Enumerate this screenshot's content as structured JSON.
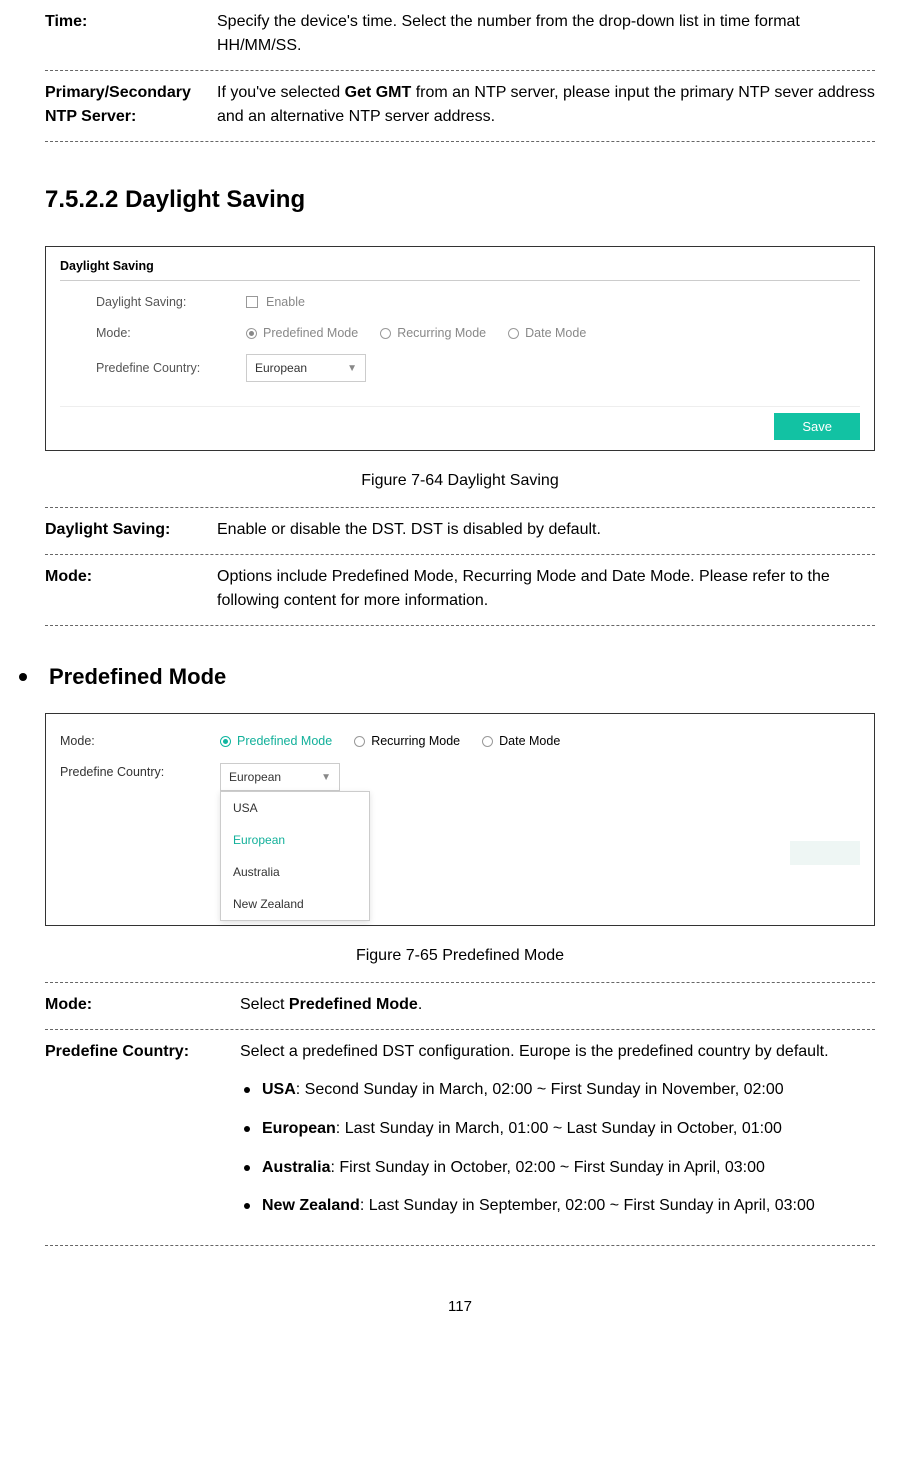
{
  "top_defs": [
    {
      "term": "Time:",
      "desc": "Specify the device's time. Select the number from the drop-down list in time format HH/MM/SS."
    },
    {
      "term": "Primary/Secondary NTP Server:",
      "desc_parts": [
        "If you've selected ",
        "Get GMT",
        " from an NTP server, please input the primary NTP sever address and an alternative NTP server address."
      ]
    }
  ],
  "section_heading": "7.5.2.2  Daylight Saving",
  "fig1": {
    "title": "Daylight Saving",
    "rows": {
      "ds_label": "Daylight Saving:",
      "ds_enable": "Enable",
      "mode_label": "Mode:",
      "mode_options": [
        "Predefined Mode",
        "Recurring Mode",
        "Date Mode"
      ],
      "pc_label": "Predefine Country:",
      "pc_value": "European"
    },
    "save": "Save"
  },
  "fig1_caption": "Figure 7-64 Daylight Saving",
  "ds_defs": [
    {
      "term": "Daylight Saving:",
      "desc": "Enable or disable the DST. DST is disabled by default."
    },
    {
      "term": "Mode:",
      "desc": "Options include Predefined Mode, Recurring Mode and Date Mode. Please refer to the following content for more information."
    }
  ],
  "bullet_heading": "Predefined Mode",
  "fig2": {
    "mode_label": "Mode:",
    "mode_options": [
      "Predefined Mode",
      "Recurring Mode",
      "Date Mode"
    ],
    "pc_label": "Predefine Country:",
    "pc_value": "European",
    "dd_items": [
      "USA",
      "European",
      "Australia",
      "New Zealand"
    ]
  },
  "fig2_caption": "Figure 7-65 Predefined Mode",
  "pd_defs": {
    "mode_term": "Mode:",
    "mode_desc_parts": [
      "Select ",
      "Predefined Mode",
      "."
    ],
    "pc_term": "Predefine Country:",
    "pc_desc": "Select a predefined DST configuration. Europe is the predefined country by default.",
    "countries": [
      {
        "name": "USA",
        "rest": ": Second Sunday in March, 02:00 ~ First Sunday in November, 02:00"
      },
      {
        "name": "European",
        "rest": ": Last Sunday in March, 01:00 ~ Last Sunday in October, 01:00"
      },
      {
        "name": "Australia",
        "rest": ": First Sunday in October, 02:00 ~ First Sunday in April, 03:00"
      },
      {
        "name": "New Zealand",
        "rest": ": Last Sunday in September, 02:00 ~ First Sunday in April, 03:00"
      }
    ]
  },
  "page_number": "117"
}
